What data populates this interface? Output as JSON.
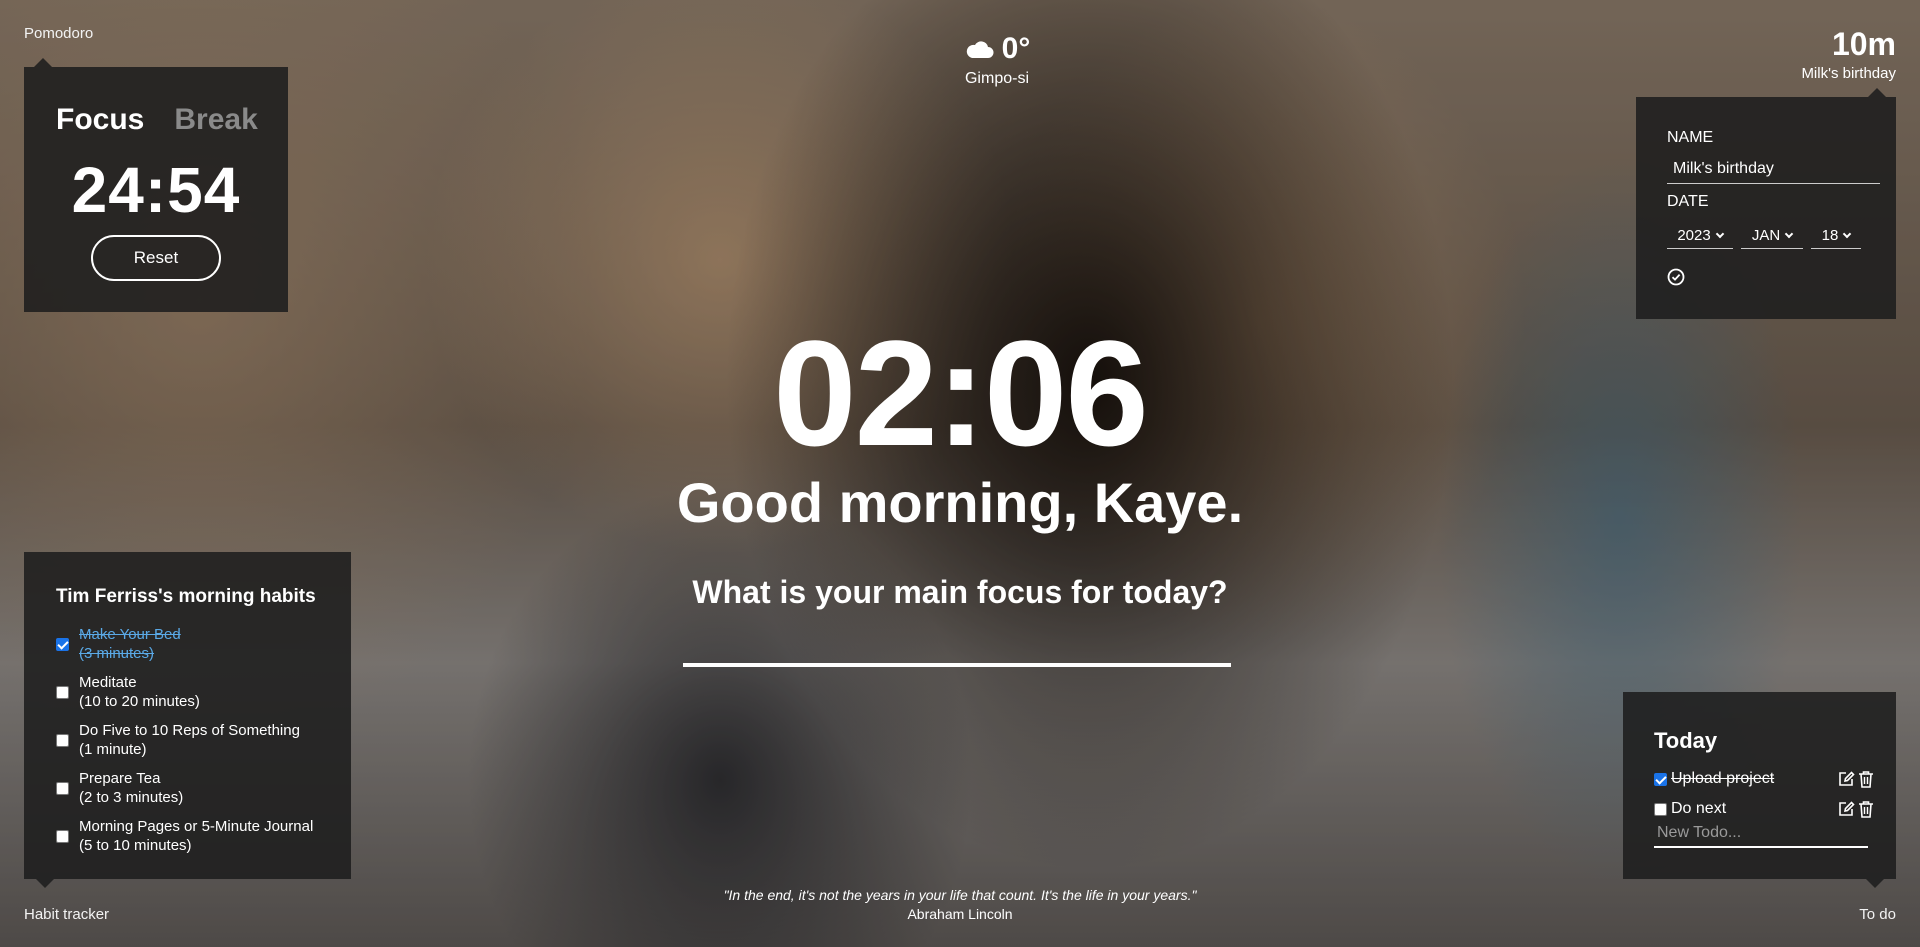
{
  "pomodoro": {
    "label": "Pomodoro",
    "tab_focus": "Focus",
    "tab_break": "Break",
    "time": "24:54",
    "reset_label": "Reset"
  },
  "weather": {
    "icon": "cloud-icon",
    "temperature": "0°",
    "city": "Gimpo-si"
  },
  "countdown": {
    "value": "10m",
    "event_name": "Milk's birthday",
    "form": {
      "name_label": "NAME",
      "name_value": "Milk's birthday",
      "date_label": "DATE",
      "year": "2023",
      "month": "JAN",
      "day": "18"
    }
  },
  "main": {
    "clock": "02:06",
    "greeting": "Good morning, Kaye.",
    "focus_question": "What is your main focus for today?"
  },
  "habits": {
    "corner_label": "Habit tracker",
    "title": "Tim Ferriss's morning habits",
    "items": [
      {
        "name": "Make Your Bed",
        "duration": "(3 minutes)",
        "checked": true
      },
      {
        "name": "Meditate",
        "duration": "(10 to 20 minutes)",
        "checked": false
      },
      {
        "name": "Do Five to 10 Reps of Something",
        "duration": "(1 minute)",
        "checked": false
      },
      {
        "name": "Prepare Tea",
        "duration": "(2 to 3 minutes)",
        "checked": false
      },
      {
        "name": "Morning Pages or 5-Minute Journal",
        "duration": "(5 to 10 minutes)",
        "checked": false
      }
    ]
  },
  "todo": {
    "corner_label": "To do",
    "title": "Today",
    "items": [
      {
        "text": "Upload project",
        "checked": true
      },
      {
        "text": "Do next",
        "checked": false
      }
    ],
    "new_placeholder": "New Todo..."
  },
  "quote": {
    "text": "\"In the end, it's not the years in your life that count. It's the life in your years.\"",
    "author": "Abraham Lincoln"
  },
  "colors": {
    "panel_bg": "#1e1e1e",
    "checkbox_accent": "#1a73e8",
    "done_habit": "#5aa9e6"
  }
}
